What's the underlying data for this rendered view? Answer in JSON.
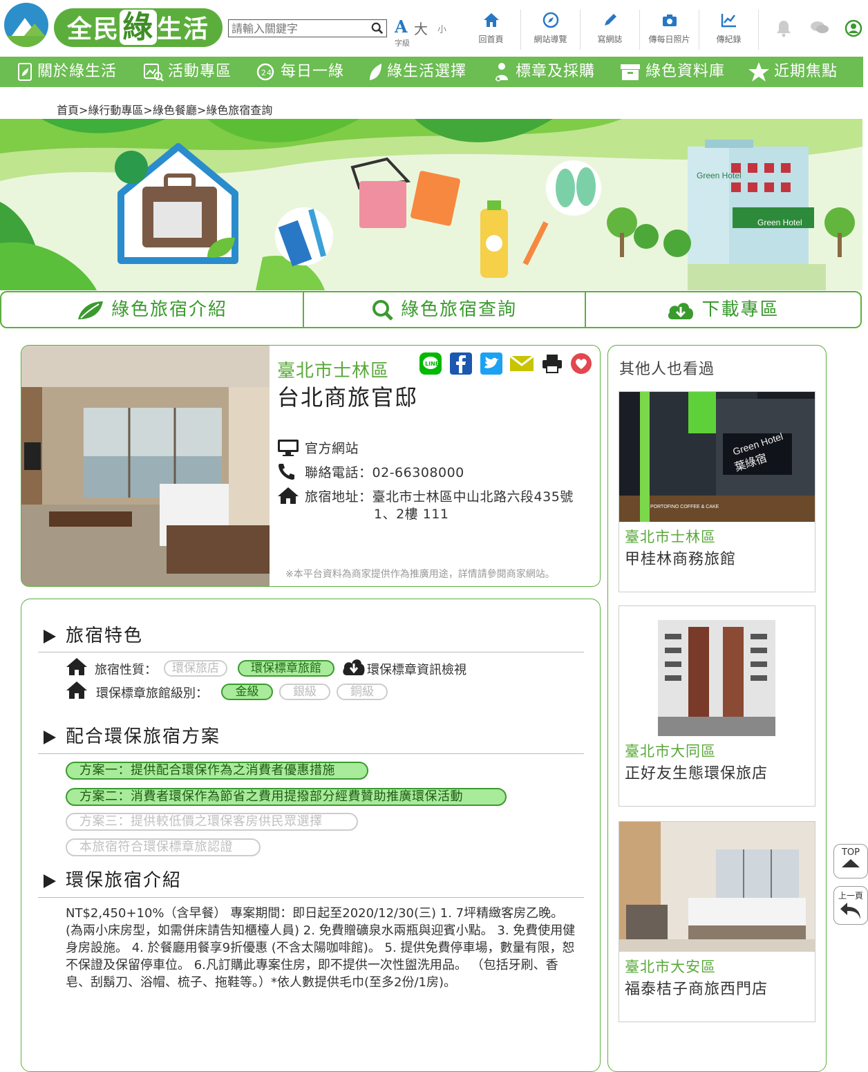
{
  "header": {
    "brand": "全民綠生活",
    "brand_parts": [
      "全民",
      "綠",
      "生活"
    ],
    "search_placeholder": "請輸入關鍵字",
    "font_size": {
      "A": "A",
      "large": "大",
      "small": "小",
      "label": "字級"
    },
    "tools": [
      {
        "label": "回首頁",
        "icon": "home-icon"
      },
      {
        "label": "網站導覽",
        "icon": "compass-icon"
      },
      {
        "label": "寫網誌",
        "icon": "pencil-icon"
      },
      {
        "label": "傳每日照片",
        "icon": "camera-icon"
      },
      {
        "label": "傳紀錄",
        "icon": "chart-icon"
      }
    ]
  },
  "nav": [
    "關於綠生活",
    "活動專區",
    "每日一綠",
    "綠生活選擇",
    "標章及採購",
    "綠色資料庫",
    "近期焦點"
  ],
  "breadcrumb": "首頁>綠行動專區>綠色餐廳>綠色旅宿查詢",
  "banner": {
    "hotel_sign_1": "Green Hotel",
    "hotel_sign_2": "Green Hotel"
  },
  "tabs": [
    "綠色旅宿介紹",
    "綠色旅宿查詢",
    "下載專區"
  ],
  "hotel": {
    "district": "臺北市士林區",
    "name": "台北商旅官邸",
    "website": "官方網站",
    "phone_label": "聯絡電話：",
    "phone": "02-66308000",
    "address_label": "旅宿地址：",
    "address_line1": "臺北市士林區中山北路六段435號",
    "address_line2": "1、2樓 111",
    "note": "※本平台資料為商家提供作為推廣用途，詳情請參閱商家網站。"
  },
  "share_icons": [
    "line-icon",
    "facebook-icon",
    "twitter-icon",
    "email-icon",
    "print-icon",
    "favorite-icon"
  ],
  "features": {
    "title": "旅宿特色",
    "type_label": "旅宿性質：",
    "type_options": [
      {
        "label": "環保旅店",
        "active": false
      },
      {
        "label": "環保標章旅館",
        "active": true
      }
    ],
    "label_info": "環保標章資訊檢視",
    "level_label": "環保標章旅館級別：",
    "levels": [
      {
        "label": "金級",
        "active": true
      },
      {
        "label": "銀級",
        "active": false
      },
      {
        "label": "銅級",
        "active": false
      }
    ]
  },
  "plans": {
    "title": "配合環保旅宿方案",
    "items": [
      {
        "label": "方案一：提供配合環保作為之消費者優惠措施",
        "active": true
      },
      {
        "label": "方案二：消費者環保作為節省之費用提撥部分經費贊助推廣環保活動",
        "active": true
      },
      {
        "label": "方案三：提供較低價之環保客房供民眾選擇",
        "active": false
      },
      {
        "label": "本旅宿符合環保標章旅認證",
        "active": false
      }
    ]
  },
  "intro": {
    "title": "環保旅宿介紹",
    "text": "NT$2,450+10%（含早餐） 專案期間：即日起至2020/12/30(三) 1. 7坪精緻客房乙晚。(為兩小床房型，如需併床請告知櫃檯人員) 2. 免費贈礦泉水兩瓶與迎賓小點。 3. 免費使用健身房設施。 4. 於餐廳用餐享9折優惠 (不含太陽咖啡館)。 5. 提供免費停車場，數量有限，恕不保證及保留停車位。 6.凡訂購此專案住房，即不提供一次性盥洗用品。 （包括牙刷、香皂、刮鬍刀、浴帽、梳子、拖鞋等。）*依人數提供毛巾(至多2份/1房)。"
  },
  "sidebar": {
    "title": "其他人也看過",
    "items": [
      {
        "district": "臺北市士林區",
        "name": "甲桂林商務旅館",
        "sign_en": "Green Hotel",
        "sign_zh": "葉綠宿",
        "shop": "PORTOFINO COFFEE & CAKE"
      },
      {
        "district": "臺北市大同區",
        "name": "正好友生態環保旅店"
      },
      {
        "district": "臺北市大安區",
        "name": "福泰桔子商旅西門店"
      }
    ]
  },
  "float_buttons": {
    "top": "TOP",
    "back": "上一頁"
  },
  "colors": {
    "brand_green": "#5cae3c",
    "nav_green": "#6cbd52",
    "accent_blue": "#2678c5",
    "active_pill": "#a8eb9a"
  }
}
